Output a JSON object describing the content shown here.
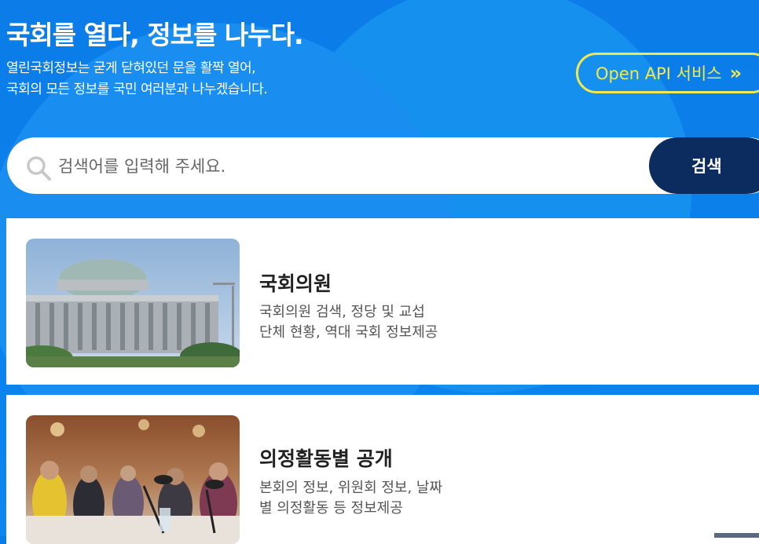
{
  "hero": {
    "headline": "국회를 열다, 정보를 나누다.",
    "subline1": "열린국회정보는 굳게 닫혀있던 문을 활짝 열어,",
    "subline2": "국회의 모든 정보를 국민 여러분과 나누겠습니다.",
    "api_button": "Open API 서비스",
    "api_chevron": "»"
  },
  "search": {
    "placeholder": "검색어를 입력해 주세요.",
    "button_label": "검색",
    "icon": "search-icon"
  },
  "cards": [
    {
      "title": "국회의원",
      "desc_line1": "국회의원 검색, 정당 및 교섭",
      "desc_line2": "단체 현황, 역대 국회 정보제공",
      "image": "national-assembly-building"
    },
    {
      "title": "의정활동별 공개",
      "desc_line1": "본회의 정보, 위원회 정보, 날짜",
      "desc_line2": "별 의정활동 등 정보제공",
      "image": "conference-meeting"
    }
  ],
  "colors": {
    "hero_blue": "#0a7ee8",
    "api_yellow": "#f2e94e",
    "search_button_navy": "#0c2b5e"
  }
}
